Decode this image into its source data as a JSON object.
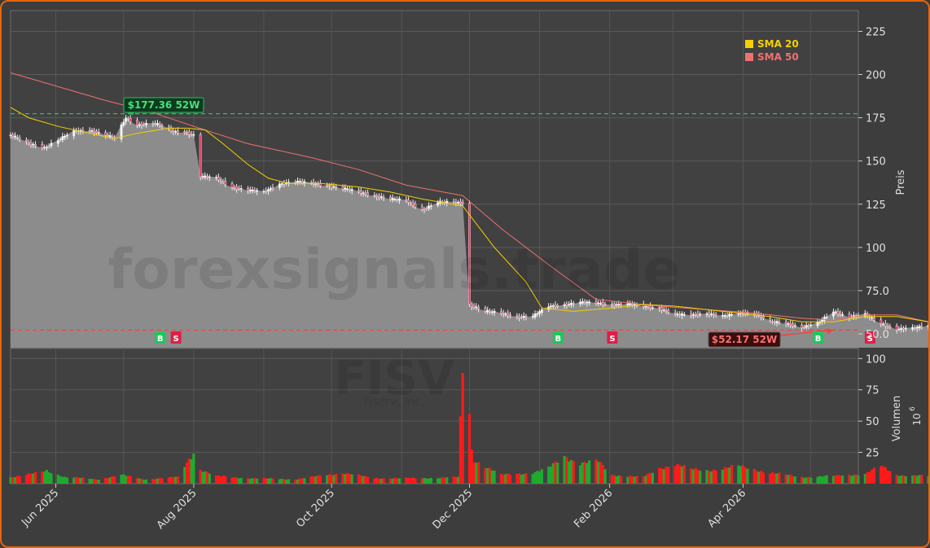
{
  "chart_data": {
    "type": "candlestick",
    "watermark": {
      "line1": "forexsignals.trade",
      "line2": "FISV",
      "line3": "Fiserv, Inc."
    },
    "legend": [
      {
        "label": "SMA 20",
        "color": "#f5d000"
      },
      {
        "label": "SMA 50",
        "color": "#f07070"
      }
    ],
    "legend_placement": "top-right",
    "price_axis": {
      "label": "Preis",
      "ticks": [
        "50.0",
        "75.0",
        "100",
        "125",
        "150",
        "175",
        "200",
        "225"
      ],
      "tick_values": [
        50,
        75,
        100,
        125,
        150,
        175,
        200,
        225
      ],
      "ylim": [
        42,
        237
      ]
    },
    "volume_axis": {
      "label": "Volumen",
      "exponent": "10",
      "exponent_power": "6",
      "ticks": [
        "25",
        "50",
        "75",
        "100"
      ],
      "tick_values": [
        25,
        50,
        75,
        100
      ],
      "ylim": [
        0,
        108
      ]
    },
    "x_axis": {
      "ticks": [
        "Jun 2025",
        "Aug 2025",
        "Oct 2025",
        "Dec 2025",
        "Feb 2026",
        "Apr 2026"
      ],
      "tick_dates": [
        "2025-06-01",
        "2025-08-01",
        "2025-10-01",
        "2025-12-01",
        "2026-02-01",
        "2026-04-01"
      ],
      "range": [
        "2025-05-12",
        "2026-05-22"
      ]
    },
    "high_52w": {
      "label": "$177.36 52W",
      "value": 177.36,
      "date": "2025-07-02"
    },
    "low_52w": {
      "label": "$52.17 52W",
      "value": 52.17,
      "date": "2026-05-11"
    },
    "signals": [
      {
        "type": "B",
        "date": "2025-07-17"
      },
      {
        "type": "S",
        "date": "2025-07-24"
      },
      {
        "type": "B",
        "date": "2026-01-09"
      },
      {
        "type": "S",
        "date": "2026-02-02"
      },
      {
        "type": "B",
        "date": "2026-05-04"
      },
      {
        "type": "S",
        "date": "2026-05-27"
      }
    ],
    "price_keyframes": [
      [
        "2025-05-12",
        165
      ],
      [
        "2025-05-20",
        160
      ],
      [
        "2025-05-27",
        158
      ],
      [
        "2025-06-02",
        162
      ],
      [
        "2025-06-09",
        167
      ],
      [
        "2025-06-16",
        168
      ],
      [
        "2025-06-23",
        165
      ],
      [
        "2025-06-27",
        163
      ],
      [
        "2025-07-02",
        175
      ],
      [
        "2025-07-07",
        171
      ],
      [
        "2025-07-14",
        172
      ],
      [
        "2025-07-18",
        170
      ],
      [
        "2025-07-23",
        167
      ],
      [
        "2025-07-28",
        167
      ],
      [
        "2025-08-01",
        165
      ],
      [
        "2025-08-04",
        141
      ],
      [
        "2025-08-11",
        140
      ],
      [
        "2025-08-18",
        135
      ],
      [
        "2025-08-25",
        133
      ],
      [
        "2025-09-01",
        132
      ],
      [
        "2025-09-08",
        137
      ],
      [
        "2025-09-15",
        138
      ],
      [
        "2025-09-22",
        137
      ],
      [
        "2025-09-29",
        136
      ],
      [
        "2025-10-06",
        134
      ],
      [
        "2025-10-13",
        132
      ],
      [
        "2025-10-20",
        130
      ],
      [
        "2025-10-27",
        128
      ],
      [
        "2025-11-03",
        127
      ],
      [
        "2025-11-10",
        122
      ],
      [
        "2025-11-17",
        126
      ],
      [
        "2025-11-25",
        126
      ],
      [
        "2025-11-28",
        126
      ],
      [
        "2025-12-01",
        67
      ],
      [
        "2025-12-08",
        63
      ],
      [
        "2025-12-15",
        62
      ],
      [
        "2025-12-22",
        60
      ],
      [
        "2025-12-29",
        60
      ],
      [
        "2026-01-05",
        66
      ],
      [
        "2026-01-12",
        67
      ],
      [
        "2026-01-19",
        68
      ],
      [
        "2026-01-26",
        68
      ],
      [
        "2026-02-02",
        67
      ],
      [
        "2026-02-09",
        67
      ],
      [
        "2026-02-16",
        66
      ],
      [
        "2026-02-23",
        65
      ],
      [
        "2026-03-02",
        61
      ],
      [
        "2026-03-09",
        61
      ],
      [
        "2026-03-16",
        62
      ],
      [
        "2026-03-23",
        60
      ],
      [
        "2026-03-30",
        62
      ],
      [
        "2026-04-06",
        62
      ],
      [
        "2026-04-13",
        57
      ],
      [
        "2026-04-20",
        56
      ],
      [
        "2026-04-27",
        54
      ],
      [
        "2026-05-04",
        56
      ],
      [
        "2026-05-11",
        63
      ],
      [
        "2026-05-18",
        60
      ],
      [
        "2026-05-25",
        61
      ],
      [
        "2026-06-01",
        56
      ],
      [
        "2026-06-08",
        53
      ],
      [
        "2026-06-15",
        53
      ],
      [
        "2026-06-22",
        55
      ]
    ],
    "sma20": [
      [
        "2025-05-12",
        181
      ],
      [
        "2025-05-20",
        175
      ],
      [
        "2025-06-02",
        170
      ],
      [
        "2025-06-16",
        166
      ],
      [
        "2025-06-27",
        163
      ],
      [
        "2025-07-07",
        166
      ],
      [
        "2025-07-21",
        169
      ],
      [
        "2025-07-29",
        169
      ],
      [
        "2025-08-06",
        168
      ],
      [
        "2025-08-14",
        160
      ],
      [
        "2025-08-25",
        148
      ],
      [
        "2025-09-03",
        140
      ],
      [
        "2025-09-12",
        137
      ],
      [
        "2025-09-26",
        137
      ],
      [
        "2025-10-13",
        135
      ],
      [
        "2025-10-27",
        132
      ],
      [
        "2025-11-10",
        128
      ],
      [
        "2025-11-28",
        124
      ],
      [
        "2025-12-12",
        100
      ],
      [
        "2025-12-26",
        80
      ],
      [
        "2026-01-02",
        65
      ],
      [
        "2026-01-16",
        63
      ],
      [
        "2026-02-02",
        65
      ],
      [
        "2026-02-16",
        67
      ],
      [
        "2026-03-02",
        66
      ],
      [
        "2026-03-16",
        64
      ],
      [
        "2026-03-30",
        62
      ],
      [
        "2026-04-13",
        60
      ],
      [
        "2026-04-27",
        57
      ],
      [
        "2026-05-11",
        57
      ],
      [
        "2026-05-25",
        60
      ],
      [
        "2026-06-08",
        60
      ],
      [
        "2026-06-22",
        57
      ]
    ],
    "sma50": [
      [
        "2025-05-12",
        201
      ],
      [
        "2025-06-02",
        193
      ],
      [
        "2025-06-23",
        185
      ],
      [
        "2025-07-14",
        178
      ],
      [
        "2025-08-01",
        170
      ],
      [
        "2025-08-25",
        160
      ],
      [
        "2025-09-22",
        152
      ],
      [
        "2025-10-13",
        145
      ],
      [
        "2025-11-03",
        136
      ],
      [
        "2025-11-28",
        130
      ],
      [
        "2025-12-15",
        111
      ],
      [
        "2026-01-05",
        90
      ],
      [
        "2026-01-26",
        70
      ],
      [
        "2026-02-09",
        68
      ],
      [
        "2026-02-23",
        66
      ],
      [
        "2026-03-16",
        64
      ],
      [
        "2026-04-06",
        62
      ],
      [
        "2026-04-27",
        59
      ],
      [
        "2026-05-11",
        58
      ],
      [
        "2026-05-25",
        61
      ],
      [
        "2026-06-08",
        61
      ],
      [
        "2026-06-22",
        57
      ]
    ],
    "volume_keyframes": [
      [
        "2025-05-12",
        6
      ],
      [
        "2025-05-22",
        9
      ],
      [
        "2025-05-28",
        12
      ],
      [
        "2025-06-05",
        6
      ],
      [
        "2025-06-20",
        4
      ],
      [
        "2025-06-30",
        8
      ],
      [
        "2025-07-10",
        4
      ],
      [
        "2025-07-25",
        6
      ],
      [
        "2025-08-01",
        29
      ],
      [
        "2025-08-04",
        13
      ],
      [
        "2025-08-11",
        7
      ],
      [
        "2025-08-25",
        5
      ],
      [
        "2025-09-15",
        4
      ],
      [
        "2025-10-06",
        10
      ],
      [
        "2025-10-20",
        5
      ],
      [
        "2025-11-10",
        5
      ],
      [
        "2025-11-26",
        6
      ],
      [
        "2025-11-28",
        104
      ],
      [
        "2025-12-01",
        65
      ],
      [
        "2025-12-02",
        30
      ],
      [
        "2025-12-03",
        22
      ],
      [
        "2025-12-08",
        16
      ],
      [
        "2025-12-15",
        8
      ],
      [
        "2025-12-29",
        10
      ],
      [
        "2026-01-05",
        14
      ],
      [
        "2026-01-12",
        25
      ],
      [
        "2026-01-19",
        19
      ],
      [
        "2026-01-27",
        20
      ],
      [
        "2026-02-02",
        8
      ],
      [
        "2026-02-16",
        6
      ],
      [
        "2026-02-23",
        14
      ],
      [
        "2026-03-02",
        18
      ],
      [
        "2026-03-09",
        13
      ],
      [
        "2026-03-16",
        12
      ],
      [
        "2026-03-30",
        16
      ],
      [
        "2026-04-13",
        10
      ],
      [
        "2026-04-27",
        6
      ],
      [
        "2026-05-11",
        7
      ],
      [
        "2026-05-25",
        9
      ],
      [
        "2026-06-01",
        16
      ],
      [
        "2026-06-08",
        8
      ],
      [
        "2026-06-22",
        7
      ]
    ]
  }
}
